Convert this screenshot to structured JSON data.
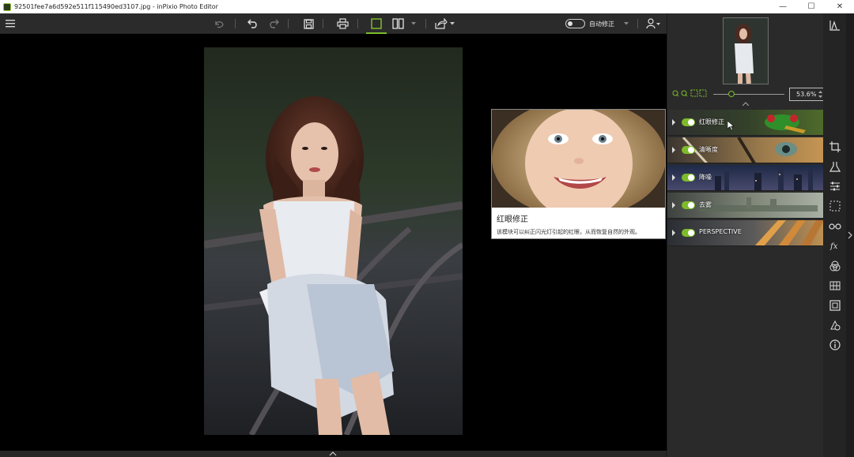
{
  "window": {
    "title": "92501fee7a6d592e511f115490ed3107.jpg - inPixio Photo Editor",
    "min_glyph": "—",
    "max_glyph": "☐",
    "close_glyph": "✕"
  },
  "toolbar": {
    "menu_icon": "hamburger-menu-icon",
    "icons": [
      "undo-all-icon",
      "undo-icon",
      "redo-icon",
      "save-icon",
      "print-icon",
      "single-view-icon",
      "split-view-icon",
      "share-icon"
    ],
    "auto_fix_label": "自动修正",
    "auto_fix_on": false,
    "account_icon": "user-icon"
  },
  "zoom": {
    "value": "53.6%",
    "slider_level": 0.25
  },
  "modules": [
    {
      "label": "红眼修正",
      "enabled": true
    },
    {
      "label": "清晰度",
      "enabled": true
    },
    {
      "label": "降噪",
      "enabled": true
    },
    {
      "label": "去雾",
      "enabled": true
    },
    {
      "label": "PERSPECTIVE",
      "enabled": true
    }
  ],
  "tooltip": {
    "title": "红眼修正",
    "description": "该模块可以纠正闪光灯引起的红眼，从而恢复自然的外观。"
  },
  "vertical_tools": [
    "histogram-icon",
    "crop-icon",
    "lab-flask-icon",
    "adjust-sliders-icon",
    "selection-icon",
    "glasses-icon",
    "fx-icon",
    "color-filter-icon",
    "texture-grid-icon",
    "frame-icon",
    "erase-shapes-icon",
    "info-icon"
  ],
  "colors": {
    "accent": "#7dbb2a",
    "panel": "#2a2a2a",
    "canvas": "#000000"
  }
}
